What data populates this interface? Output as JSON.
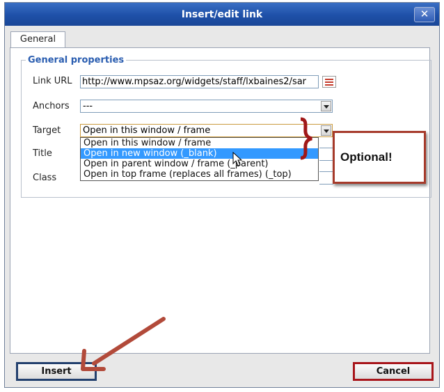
{
  "dialog": {
    "title": "Insert/edit link",
    "close_label": "✕"
  },
  "tabs": [
    {
      "label": "General"
    }
  ],
  "section": {
    "legend": "General properties"
  },
  "fields": {
    "link_url": {
      "label": "Link URL",
      "value": "http://www.mpsaz.org/widgets/staff/lxbaines2/sar"
    },
    "anchors": {
      "label": "Anchors",
      "value": "---"
    },
    "target": {
      "label": "Target",
      "value": "Open in this window / frame",
      "options": [
        "Open in this window / frame",
        "Open in new window (_blank)",
        "Open in parent window / frame (_parent)",
        "Open in top frame (replaces all frames) (_top)"
      ],
      "highlighted_index": 1
    },
    "title": {
      "label": "Title"
    },
    "class": {
      "label": "Class"
    }
  },
  "annotation": {
    "text": "Optional!",
    "color": "#a63a2a"
  },
  "buttons": {
    "insert": "Insert",
    "cancel": "Cancel"
  },
  "colors": {
    "titlebar": "#1e50a8",
    "legend": "#2a5db0",
    "highlight": "#3399ff",
    "annotation_red": "#a63a2a"
  }
}
